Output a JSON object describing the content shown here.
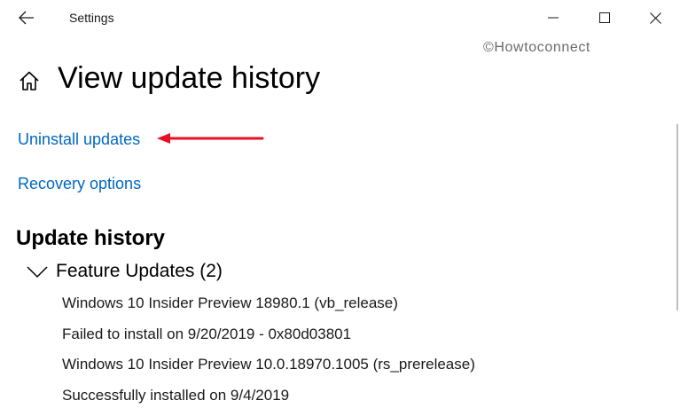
{
  "window": {
    "app_title": "Settings",
    "back_icon": "back-arrow-icon",
    "minimize_icon": "minimize-icon",
    "maximize_icon": "maximize-icon",
    "close_icon": "close-icon"
  },
  "watermark": "©Howtoconnect",
  "header": {
    "home_icon": "home-icon",
    "title": "View update history"
  },
  "links": {
    "uninstall": "Uninstall updates",
    "recovery": "Recovery options"
  },
  "annotation": {
    "arrow_color": "#e81123"
  },
  "update_history": {
    "heading": "Update history",
    "groups": [
      {
        "label": "Feature Updates (2)",
        "expanded": true,
        "entries": [
          {
            "name": "Windows 10 Insider Preview 18980.1 (vb_release)",
            "status": "Failed to install on 9/20/2019 - 0x80d03801"
          },
          {
            "name": "Windows 10 Insider Preview 10.0.18970.1005 (rs_prerelease)",
            "status": "Successfully installed on 9/4/2019"
          }
        ]
      }
    ]
  },
  "colors": {
    "link": "#0067c0",
    "text": "#000000",
    "background": "#ffffff"
  }
}
